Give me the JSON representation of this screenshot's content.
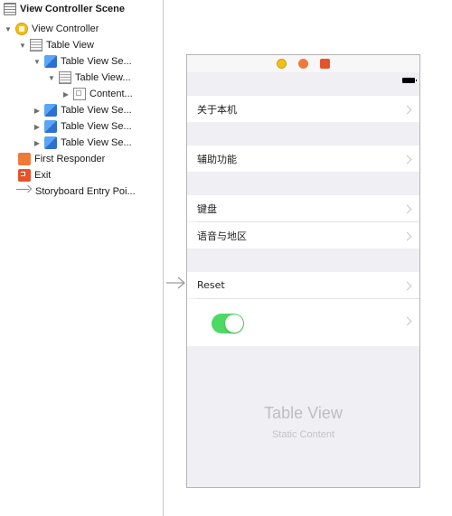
{
  "outline": {
    "scene_title": "View Controller Scene",
    "items": [
      {
        "label": "View Controller",
        "icon": "view-controller-icon"
      },
      {
        "label": "Table View",
        "icon": "table-view-icon"
      },
      {
        "label": "Table View Se...",
        "icon": "cube-icon"
      },
      {
        "label": "Table View...",
        "icon": "table-view-icon"
      },
      {
        "label": "Content...",
        "icon": "content-view-icon"
      },
      {
        "label": "Table View Se...",
        "icon": "cube-icon"
      },
      {
        "label": "Table View Se...",
        "icon": "cube-icon"
      },
      {
        "label": "Table View Se...",
        "icon": "cube-icon"
      },
      {
        "label": "First Responder",
        "icon": "first-responder-icon"
      },
      {
        "label": "Exit",
        "icon": "exit-icon"
      },
      {
        "label": "Storyboard Entry Poi...",
        "icon": "entry-arrow-icon"
      }
    ]
  },
  "canvas": {
    "cells": {
      "about": "关于本机",
      "accessibility": "辅助功能",
      "keyboard": "键盘",
      "language_region": "语音与地区",
      "reset": "Reset"
    },
    "toggle_on": true,
    "placeholder_title": "Table View",
    "placeholder_subtitle": "Static Content"
  },
  "colors": {
    "toggle_on": "#4cd964",
    "group_background": "#efeff4",
    "view_controller_icon": "#f2c01c",
    "first_responder_icon": "#ee7a3a",
    "exit_icon": "#e5532b",
    "table_section_icon": "#3b82e0"
  }
}
